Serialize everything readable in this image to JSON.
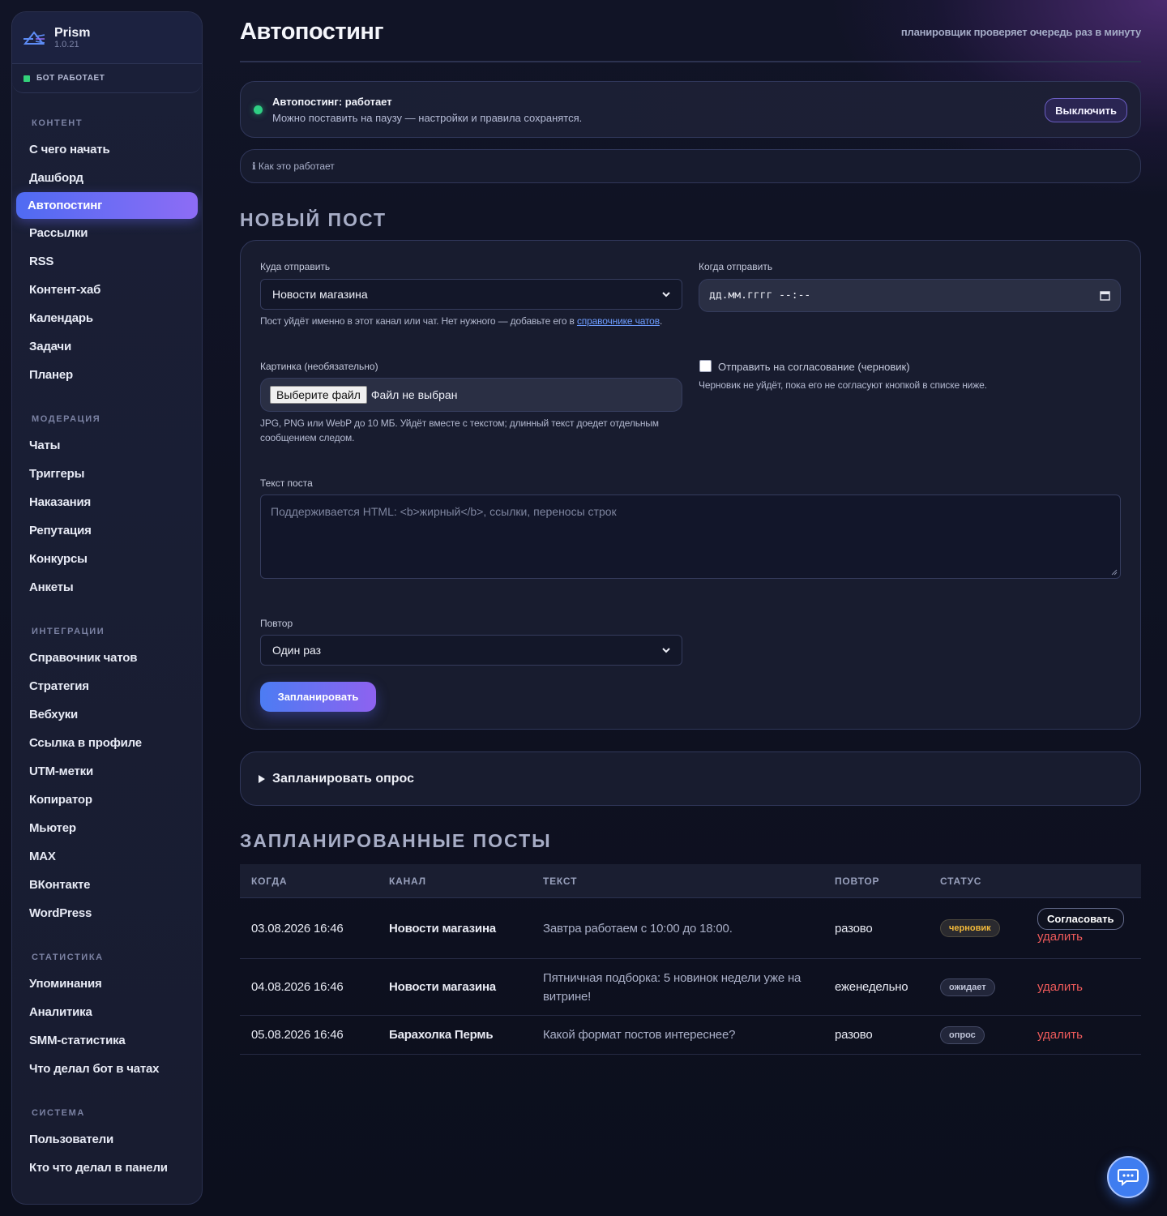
{
  "brand": {
    "name": "Prism",
    "version": "1.0.21"
  },
  "bot_status": "БОТ РАБОТАЕТ",
  "sidebar": {
    "groups": [
      {
        "header": "КОНТЕНТ",
        "items": [
          "С чего начать",
          "Дашборд",
          "Автопостинг",
          "Рассылки",
          "RSS",
          "Контент-хаб",
          "Календарь",
          "Задачи",
          "Планер"
        ]
      },
      {
        "header": "МОДЕРАЦИЯ",
        "items": [
          "Чаты",
          "Триггеры",
          "Наказания",
          "Репутация",
          "Конкурсы",
          "Анкеты"
        ]
      },
      {
        "header": "ИНТЕГРАЦИИ",
        "items": [
          "Справочник чатов",
          "Стратегия",
          "Вебхуки",
          "Ссылка в профиле",
          "UTM-метки",
          "Копиратор",
          "Мьютер",
          "MAX",
          "ВКонтакте",
          "WordPress"
        ]
      },
      {
        "header": "СТАТИСТИКА",
        "items": [
          "Упоминания",
          "Аналитика",
          "SMM-статистика",
          "Что делал бот в чатах"
        ]
      },
      {
        "header": "СИСТЕМА",
        "items": [
          "Пользователи",
          "Кто что делал в панели"
        ]
      }
    ],
    "active": "Автопостинг"
  },
  "header": {
    "title": "Автопостинг",
    "hint": "планировщик проверяет очередь раз в минуту"
  },
  "status_card": {
    "title": "Автопостинг: работает",
    "subtitle": "Можно поставить на паузу — настройки и правила сохранятся.",
    "toggle_label": "Выключить"
  },
  "howto": "ℹ Как это работает",
  "new_post": {
    "section_title": "НОВЫЙ ПОСТ",
    "target_label": "Куда отправить",
    "target_value": "Новости магазина",
    "target_help_prefix": "Пост уйдёт именно в этот канал или чат. Нет нужного — добавьте его в ",
    "target_help_link": "справочнике чатов",
    "target_help_suffix": ".",
    "when_label": "Когда отправить",
    "when_placeholder": "дд.мм.гггг --:--",
    "image_label": "Картинка (необязательно)",
    "file_button": "Выберите файл",
    "file_none": "Файл не выбран",
    "image_help": "JPG, PNG или WebP до 10 МБ. Уйдёт вместе с текстом; длинный текст доедет отдельным сообщением следом.",
    "draft_label": "Отправить на согласование (черновик)",
    "draft_help": "Черновик не уйдёт, пока его не согласуют кнопкой в списке ниже.",
    "text_label": "Текст поста",
    "text_placeholder": "Поддерживается HTML: <b>жирный</b>, ссылки, переносы строк",
    "repeat_label": "Повтор",
    "repeat_value": "Один раз",
    "submit_label": "Запланировать"
  },
  "poll_card": {
    "label": "Запланировать опрос"
  },
  "scheduled": {
    "section_title": "ЗАПЛАНИРОВАННЫЕ ПОСТЫ",
    "columns": [
      "КОГДА",
      "КАНАЛ",
      "ТЕКСТ",
      "ПОВТОР",
      "СТАТУС"
    ],
    "rows": [
      {
        "when": "03.08.2026 16:46",
        "channel": "Новости магазина",
        "text": "Завтра работаем с 10:00 до 18:00.",
        "repeat": "разово",
        "status": "черновик",
        "approve": "Согласовать",
        "delete": "удалить"
      },
      {
        "when": "04.08.2026 16:46",
        "channel": "Новости магазина",
        "text": "Пятничная подборка: 5 новинок недели уже на витрине!",
        "repeat": "еженедельно",
        "status": "ожидает",
        "delete": "удалить"
      },
      {
        "when": "05.08.2026 16:46",
        "channel": "Барахолка Пермь",
        "text": "Какой формат постов интереснее?",
        "repeat": "разово",
        "status": "опрос",
        "delete": "удалить"
      }
    ]
  },
  "colors": {
    "accent_start": "#4f6bf2",
    "accent_end": "#8d6cf5",
    "ok": "#33d17a",
    "danger": "#f05b5b",
    "draft": "#f2b93b"
  }
}
